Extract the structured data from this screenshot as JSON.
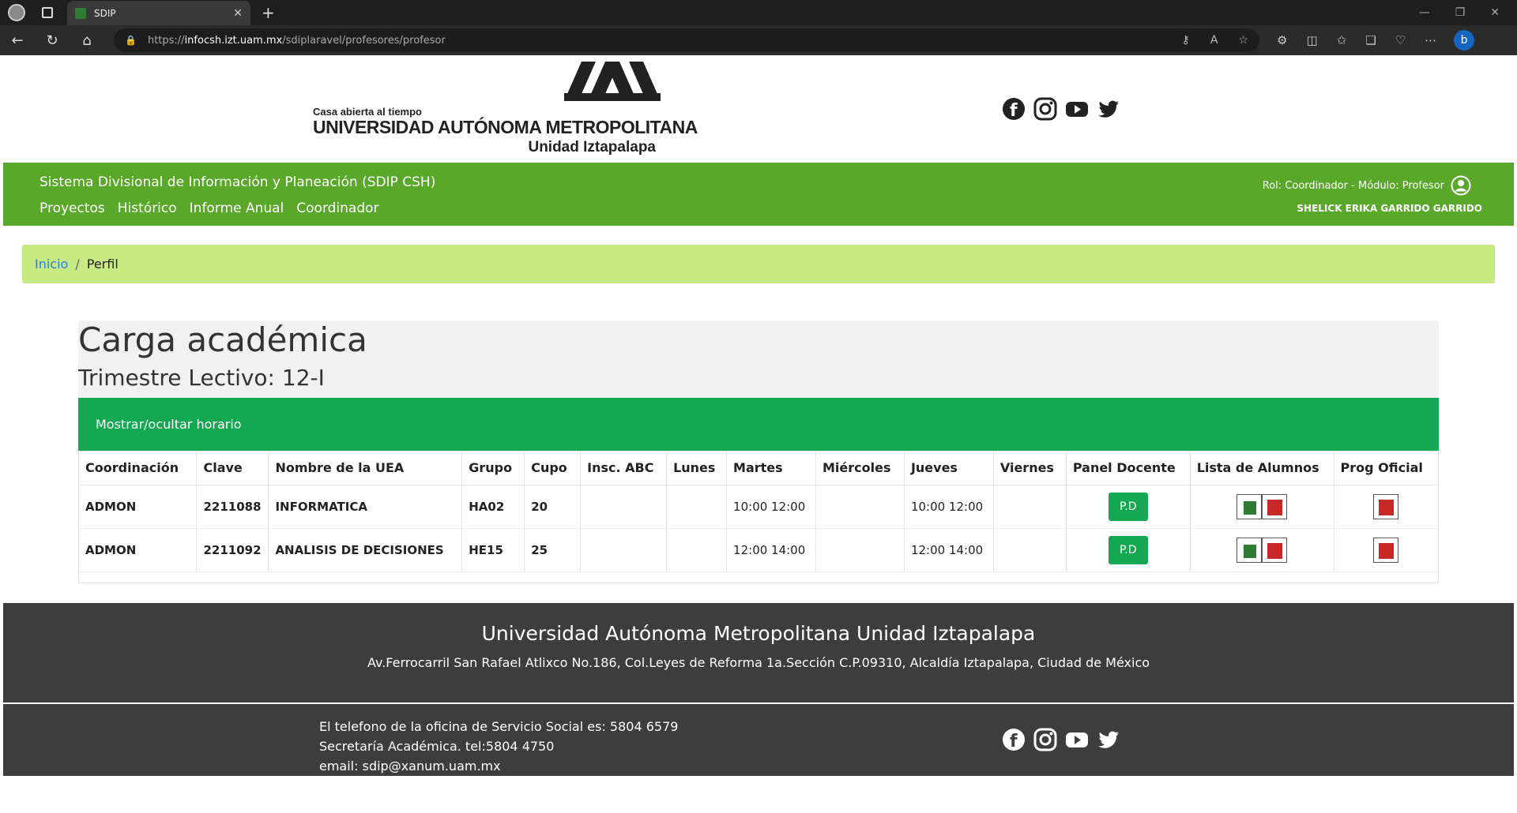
{
  "browser": {
    "tab_title": "SDIP",
    "url_prefix": "https://",
    "url_host": "infocsh.izt.uam.mx",
    "url_path": "/sdiplaravel/profesores/profesor"
  },
  "logo": {
    "small_text": "Casa abierta al tiempo",
    "big_text": "UNIVERSIDAD AUTÓNOMA METROPOLITANA",
    "unit_text": "Unidad Iztapalapa"
  },
  "navbar": {
    "system_name": "Sistema Divisional de Información y Planeación (SDIP CSH)",
    "menu": [
      "Proyectos",
      "Histórico",
      "Informe Anual",
      "Coordinador"
    ],
    "role": "Rol: Coordinador - Módulo: Profesor",
    "user": "SHELICK ERIKA GARRIDO GARRIDO"
  },
  "breadcrumb": {
    "home": "Inicio",
    "sep": "/",
    "current": "Perfil"
  },
  "main": {
    "title": "Carga académica",
    "subtitle": "Trimestre Lectivo: 12-I",
    "toggle_label": "Mostrar/ocultar horario",
    "columns": [
      "Coordinación",
      "Clave",
      "Nombre de la UEA",
      "Grupo",
      "Cupo",
      "Insc. ABC",
      "Lunes",
      "Martes",
      "Miércoles",
      "Jueves",
      "Viernes",
      "Panel Docente",
      "Lista de Alumnos",
      "Prog Oficial"
    ],
    "rows": [
      {
        "coord": "ADMON",
        "clave": "2211088",
        "nombre": "INFORMATICA",
        "grupo": "HA02",
        "cupo": "20",
        "insc": "",
        "lunes": "",
        "martes": "10:00 12:00",
        "miercoles": "",
        "jueves": "10:00 12:00",
        "viernes": "",
        "panel": "P.D"
      },
      {
        "coord": "ADMON",
        "clave": "2211092",
        "nombre": "ANALISIS DE DECISIONES",
        "grupo": "HE15",
        "cupo": "25",
        "insc": "",
        "lunes": "",
        "martes": "12:00 14:00",
        "miercoles": "",
        "jueves": "12:00 14:00",
        "viernes": "",
        "panel": "P.D"
      }
    ]
  },
  "footer": {
    "university": "Universidad Autónoma Metropolitana Unidad Iztapalapa",
    "address": "Av.Ferrocarril San Rafael Atlixco No.186, Col.Leyes de Reforma 1a.Sección C.P.09310, Alcaldía Iztapalapa, Ciudad de México",
    "phone": "El telefono de la oficina de Servicio Social es: 5804 6579",
    "secretaria": "Secretaría Académica. tel:5804 4750",
    "email": "email: sdip@xanum.uam.mx"
  },
  "colors": {
    "navbar": "#5aa829",
    "toggle": "#14a852",
    "breadcrumb": "#c7eb82",
    "footer": "#3d3d3d"
  }
}
